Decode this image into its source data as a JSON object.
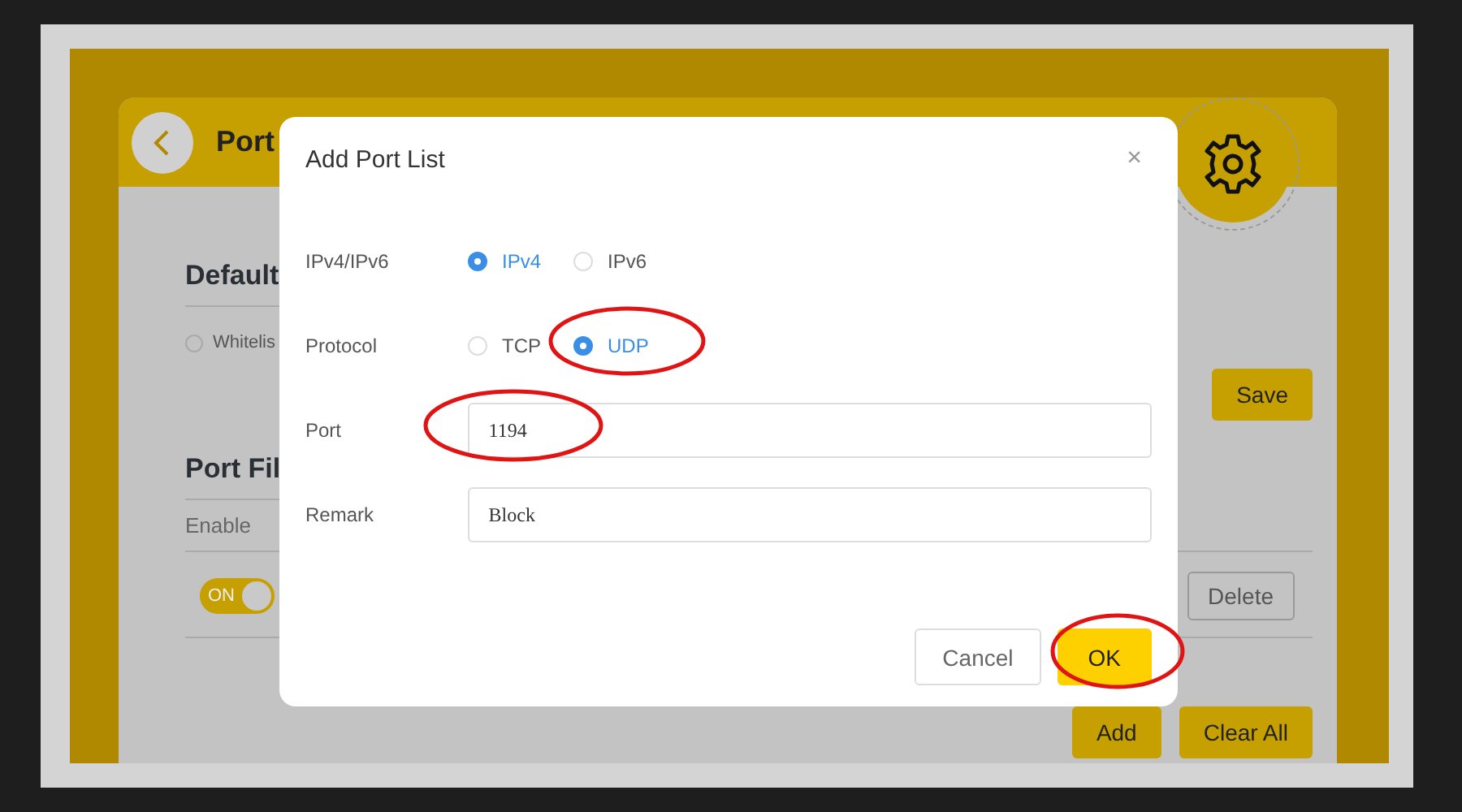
{
  "page": {
    "title": "Port",
    "default_section": {
      "heading": "Default",
      "options": [
        {
          "label": "Whitelis",
          "selected": false
        }
      ],
      "save_button": "Save"
    },
    "filter_section": {
      "heading": "Port Fil",
      "enable_label": "Enable",
      "toggle": {
        "label": "ON",
        "on": true
      },
      "delete_button": "Delete",
      "add_button": "Add",
      "clear_button": "Clear All"
    }
  },
  "dialog": {
    "title": "Add Port List",
    "close": "×",
    "fields": [
      {
        "kind": "radio",
        "label": "IPv4/IPv6",
        "options": [
          {
            "label": "IPv4",
            "selected": true
          },
          {
            "label": "IPv6",
            "selected": false
          }
        ]
      },
      {
        "kind": "radio",
        "label": "Protocol",
        "options": [
          {
            "label": "TCP",
            "selected": false
          },
          {
            "label": "UDP",
            "selected": true
          }
        ]
      },
      {
        "kind": "text",
        "label": "Port",
        "value": "1194"
      },
      {
        "kind": "text",
        "label": "Remark",
        "value": "Block"
      }
    ],
    "buttons": [
      {
        "label": "Cancel",
        "primary": false
      },
      {
        "label": "OK",
        "primary": true
      }
    ]
  }
}
